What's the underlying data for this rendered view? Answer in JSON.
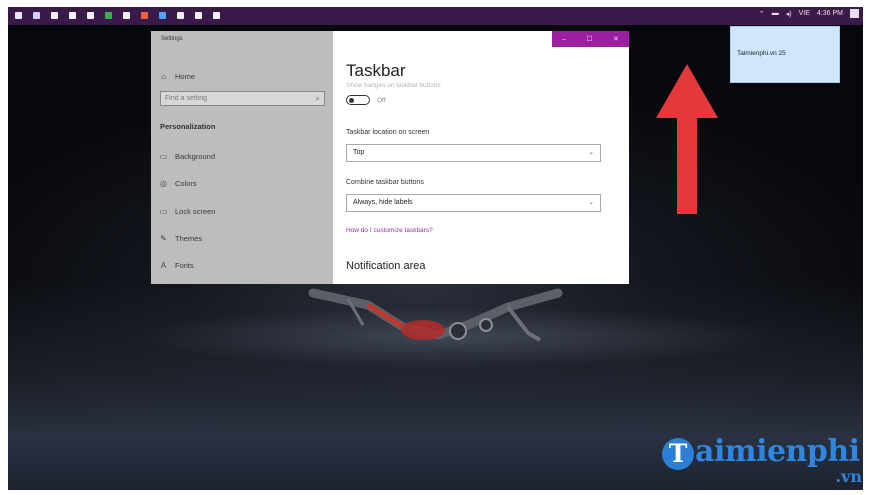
{
  "taskbar": {
    "icons": [
      "start-icon",
      "task-view-icon",
      "folder-icon",
      "store-icon",
      "photos-icon",
      "app-icon",
      "terminal-icon",
      "chrome-icon",
      "app-icon-2",
      "app-icon-3",
      "app-icon-4",
      "gear-icon"
    ],
    "icon_colors": [
      "#e8e8ff",
      "#d0d0ff",
      "#f2f2f2",
      "#f2f2f2",
      "#f2f2f2",
      "#2fb34a",
      "#f2f2f2",
      "#f25f3a",
      "#4aa3ff",
      "#f2f2f2",
      "#f2f2f2",
      "#f2f2f2"
    ],
    "tray_text": [
      "VIE",
      "4:36 PM"
    ]
  },
  "notification": {
    "text": "Taimienphi.vn 25"
  },
  "settings": {
    "window_title": "Settings",
    "nav": {
      "home": "Home",
      "search_placeholder": "Find a setting",
      "section": "Personalization",
      "items": [
        {
          "label": "Background",
          "icon": "background-icon"
        },
        {
          "label": "Colors",
          "icon": "palette-icon"
        },
        {
          "label": "Lock screen",
          "icon": "lock-screen-icon"
        },
        {
          "label": "Themes",
          "icon": "themes-icon"
        },
        {
          "label": "Fonts",
          "icon": "fonts-icon"
        }
      ]
    },
    "content": {
      "title": "Taskbar",
      "badge_label": "Show badges on taskbar buttons",
      "toggle_state": "Off",
      "location_label": "Taskbar location on screen",
      "location_value": "Top",
      "combine_label": "Combine taskbar buttons",
      "combine_value": "Always, hide labels",
      "help_link": "How do I customize taskbars?",
      "section_title": "Notification area"
    }
  },
  "watermark": {
    "brand": "aimienphi",
    "initial": "T",
    "suffix": ".vn"
  },
  "colors": {
    "accent": "#9b1fa0",
    "taskbar": "#3a1a48",
    "arrow": "#e5383b"
  }
}
